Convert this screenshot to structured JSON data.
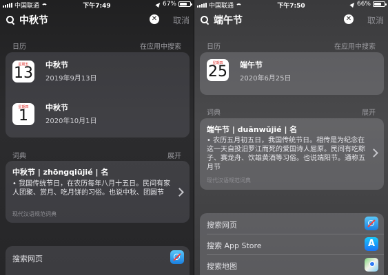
{
  "left": {
    "status": {
      "carrier": "中国联通",
      "time": "下午7:49",
      "battery": "67%",
      "battery_level": 0.67
    },
    "search": {
      "query": "中秋节",
      "cancel": "取消"
    },
    "calendar": {
      "header": "日历",
      "header_right": "在应用中搜索",
      "events": [
        {
          "dow": "星期五",
          "day": "13",
          "title": "中秋节",
          "date": "2019年9月13日"
        },
        {
          "dow": "星期四",
          "day": "1",
          "title": "中秋节",
          "date": "2020年10月1日"
        }
      ]
    },
    "dictionary": {
      "header": "词典",
      "header_right": "展开",
      "title": "中秋节 | zhōngqiūjié | 名",
      "definition": "• 我国传统节日，在农历每年八月十五日。民间有家人团聚、赏月、吃月饼的习俗。也说中秋、团圆节",
      "source": "现代汉语规范词典"
    },
    "suggestions": [
      {
        "label": "搜索网页",
        "icon": "safari-icon"
      }
    ]
  },
  "right": {
    "status": {
      "carrier": "中国联通",
      "time": "下午7:50",
      "battery": "66%",
      "battery_level": 0.66
    },
    "search": {
      "query": "端午节",
      "cancel": "取消"
    },
    "calendar": {
      "header": "日历",
      "header_right": "在应用中搜索",
      "events": [
        {
          "dow": "星期四",
          "day": "25",
          "title": "端午节",
          "date": "2020年6月25日"
        }
      ]
    },
    "dictionary": {
      "header": "词典",
      "header_right": "展开",
      "title": "端午节 | duānwǔjié | 名",
      "definition": "• 农历五月初五日，我国传统节日。相传是为纪念在这一天自投汨罗江而死的爱国诗人屈原。民间有吃粽子、赛龙舟、饮雄黄酒等习俗。也说端阳节。通称五月节",
      "source": "现代汉语规范词典"
    },
    "suggestions": [
      {
        "label": "搜索网页",
        "icon": "safari-icon"
      },
      {
        "label": "搜索 App Store",
        "icon": "app-store-icon"
      },
      {
        "label": "搜索地图",
        "icon": "maps-icon"
      }
    ]
  }
}
